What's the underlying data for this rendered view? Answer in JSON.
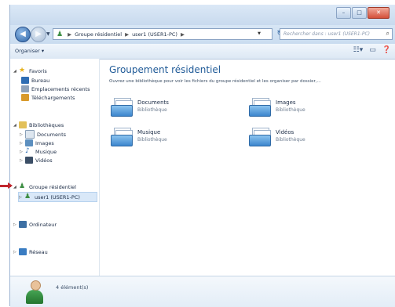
{
  "colors": {
    "accent": "#1f5a97",
    "selected": "#d9e8f8",
    "arrow": "#c0262d"
  },
  "addressbar": {
    "path": [
      "Groupe résidentiel",
      "user1 (USER1-PC)"
    ],
    "search_placeholder": "Rechercher dans : user1 (USER1-PC)"
  },
  "toolbar": {
    "organize_label": "Organiser ▾"
  },
  "nav": {
    "favorites": {
      "label": "Favoris",
      "items": [
        "Bureau",
        "Emplacements récents",
        "Téléchargements"
      ]
    },
    "libraries": {
      "label": "Bibliothèques",
      "items": [
        "Documents",
        "Images",
        "Musique",
        "Vidéos"
      ]
    },
    "homegroup": {
      "label": "Groupe résidentiel",
      "items": [
        "user1 (USER1-PC)"
      ]
    },
    "computer": {
      "label": "Ordinateur"
    },
    "network": {
      "label": "Réseau"
    }
  },
  "main": {
    "title": "Groupement résidentiel",
    "subtitle": "Ouvrez une bibliothèque pour voir les fichiers du groupe résidentiel et les organiser par dossier,...",
    "libraries": [
      {
        "name": "Documents",
        "type": "Bibliothèque"
      },
      {
        "name": "Images",
        "type": "Bibliothèque"
      },
      {
        "name": "Musique",
        "type": "Bibliothèque"
      },
      {
        "name": "Vidéos",
        "type": "Bibliothèque"
      }
    ]
  },
  "details": {
    "count": "4 élément(s)"
  }
}
